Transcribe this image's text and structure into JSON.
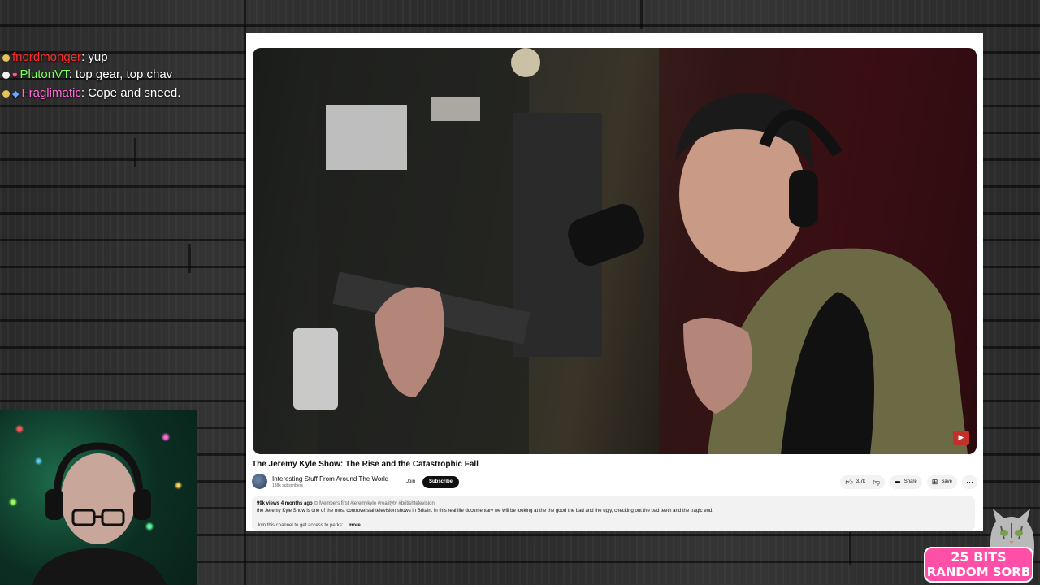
{
  "chat": {
    "messages": [
      {
        "user": "fnordmonger",
        "text": ": yup"
      },
      {
        "user": "PlutonVT",
        "text": ": top gear, top chav"
      },
      {
        "user": "Fraglimatic",
        "text": ": Cope and sneed."
      }
    ]
  },
  "video": {
    "title": "The Jeremy Kyle Show: The Rise and the Catastrophic Fall",
    "channel_name": "Interesting Stuff From Around The World",
    "channel_subs": "138k subscribers",
    "join_label": "Join",
    "subscribe_label": "Subscribe",
    "likes": "3.7k",
    "share_label": "Share",
    "save_label": "Save",
    "desc_meta": "99k views  4 months ago",
    "desc_tags": "  ⊙ Members first  #jeremykyle #realitytv #britishtelevision",
    "desc_line1": "the Jeremy Kyle Show is one of the most controversial television shows in Britain. in this real life documentary we will be looking at the the good the bad and the ugly, checking out the bad teeth and the tragic end.",
    "desc_line2": "Join this channel to get access to perks:",
    "desc_more": "...more"
  },
  "alert": {
    "line1": "25 BITS",
    "line2": "RANDOM SORB"
  },
  "colors": {
    "user1": "#ff2d2d",
    "user2": "#7cff5a",
    "user3": "#ff6ad5",
    "alert_bg": "#ff4fa6"
  }
}
